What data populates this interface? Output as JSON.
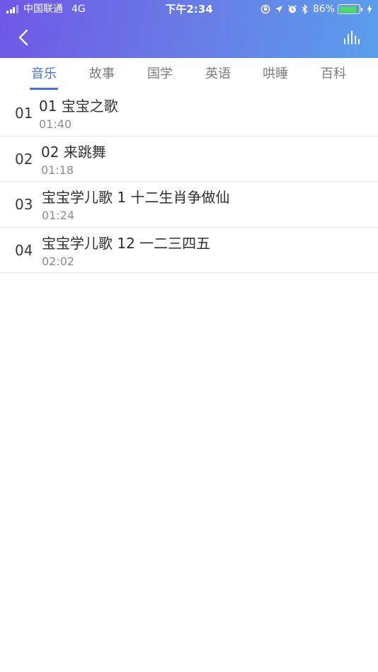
{
  "status_bar": {
    "carrier": "中国联通",
    "network": "4G",
    "time": "下午2:34",
    "battery_percent": "86%",
    "battery_level": 0.86,
    "icons": [
      "signal-icon",
      "rotation-lock-icon",
      "location-icon",
      "alarm-icon",
      "bluetooth-icon",
      "battery-icon",
      "charging-icon"
    ]
  },
  "header": {
    "back_icon": "chevron-left-icon",
    "right_icon": "equalizer-icon",
    "gradient_colors": [
      "#6f57e6",
      "#5a9eec"
    ]
  },
  "tabs": [
    {
      "label": "音乐",
      "active": true
    },
    {
      "label": "故事",
      "active": false
    },
    {
      "label": "国学",
      "active": false
    },
    {
      "label": "英语",
      "active": false
    },
    {
      "label": "哄睡",
      "active": false
    },
    {
      "label": "百科",
      "active": false
    }
  ],
  "accent_color": "#4a72d6",
  "tracks": [
    {
      "index": "01",
      "title": "01 宝宝之歌",
      "duration": "01:40"
    },
    {
      "index": "02",
      "title": "02 来跳舞",
      "duration": "01:18"
    },
    {
      "index": "03",
      "title": "宝宝学儿歌 1 十二生肖争做仙",
      "duration": "01:24"
    },
    {
      "index": "04",
      "title": "宝宝学儿歌 12 一二三四五",
      "duration": "02:02"
    }
  ]
}
